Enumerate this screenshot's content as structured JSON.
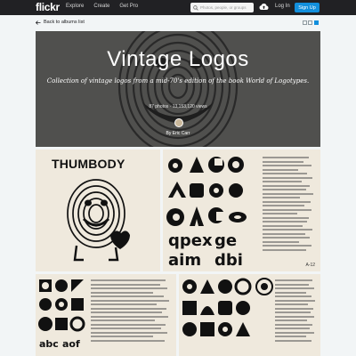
{
  "nav": {
    "logo": "flickr",
    "links": [
      "Explore",
      "Create",
      "Get Pro"
    ],
    "search_placeholder": "Photos, people, or groups",
    "login": "Log In",
    "signup": "Sign Up"
  },
  "subnav": {
    "back": "Back to albums list"
  },
  "album": {
    "title": "Vintage Logos",
    "description": "Collection of vintage logos from a mid-70's edition of the book World of Logotypes.",
    "stats": "87 photos  ·  13,153,120 views",
    "owner": "By Eric Carr"
  },
  "photos": [
    {
      "text": "THUMBODY"
    },
    {
      "plate": "A-12"
    }
  ],
  "colors": {
    "nav_bg": "#212124",
    "accent": "#128fdc",
    "page_bg": "#f2f5f6"
  }
}
